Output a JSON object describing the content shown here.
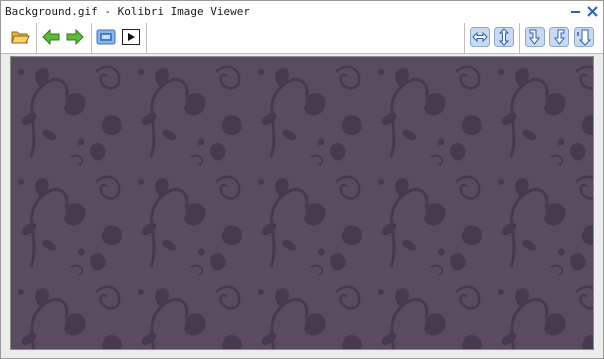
{
  "window": {
    "title": "Background.gif - Kolibri Image Viewer"
  },
  "titlebar_controls": [
    {
      "name": "minimize-button",
      "icon": "minimize-icon"
    },
    {
      "name": "close-button",
      "icon": "close-icon"
    }
  ],
  "toolbar": {
    "left_groups": [
      [
        "open-folder-icon"
      ],
      [
        "previous-arrow-icon",
        "next-arrow-icon"
      ],
      [
        "slideshow-icon",
        "play-icon"
      ]
    ],
    "right_group": [
      "fit-width-icon",
      "fit-height-icon",
      "rotate-right-icon",
      "rotate-left-icon",
      "flip-icon"
    ]
  },
  "image": {
    "file": "Background.gif",
    "description_colors": {
      "background": "#5a4b5f",
      "pattern": "#473a4c"
    }
  },
  "colors": {
    "accent_green": "#4caa2f",
    "accent_blue": "#3f7fd4",
    "icon_button_bg": "#c9d9ef"
  }
}
